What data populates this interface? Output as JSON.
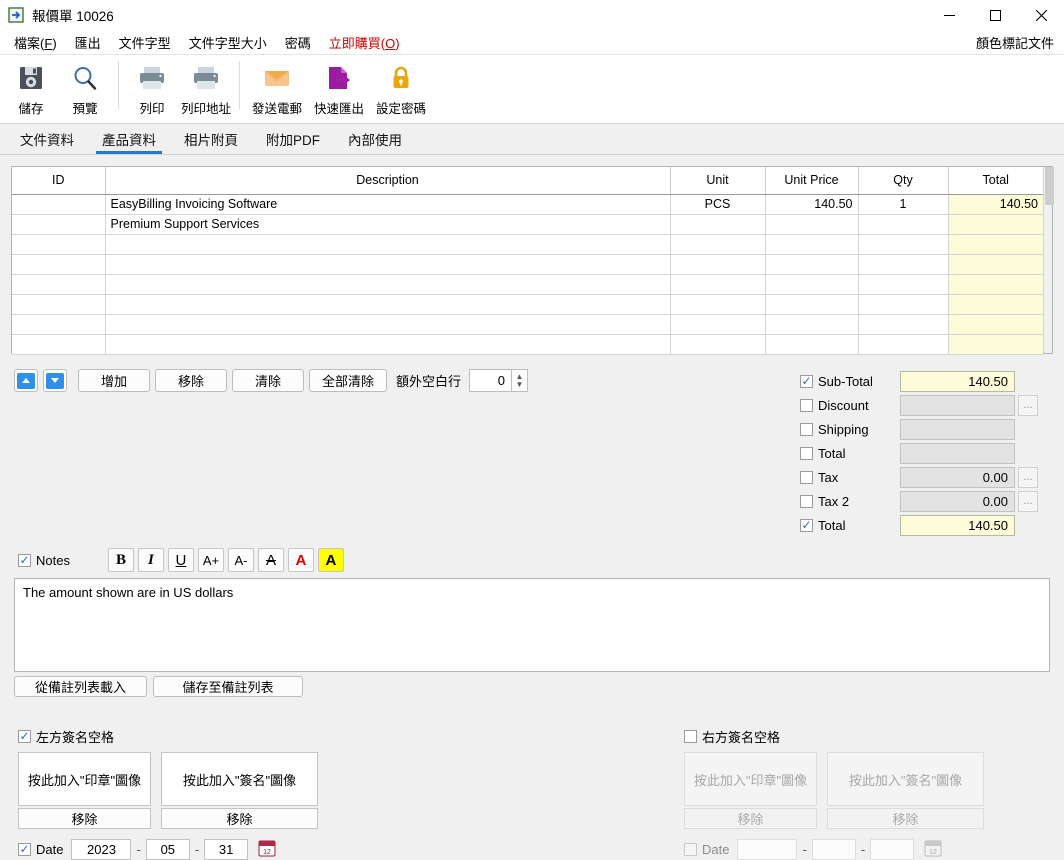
{
  "window": {
    "icon": "export-document-icon",
    "title": "報價單 10026",
    "minimize": "−",
    "maximize": "□",
    "close": "✕"
  },
  "menubar": {
    "items": [
      {
        "label": "檔案",
        "accel": "F",
        "name": "menu-file"
      },
      {
        "label": "匯出",
        "accel": "",
        "name": "menu-export"
      },
      {
        "label": "文件字型",
        "accel": "",
        "name": "menu-doc-font"
      },
      {
        "label": "文件字型大小",
        "accel": "",
        "name": "menu-doc-font-size"
      },
      {
        "label": "密碼",
        "accel": "",
        "name": "menu-password"
      },
      {
        "label": "立即購買",
        "accel": "O",
        "name": "menu-buy-now"
      }
    ],
    "right_label": "顏色標記文件"
  },
  "toolbar": {
    "buttons": [
      {
        "label": "儲存",
        "icon": "save-icon",
        "name": "toolbar-save"
      },
      {
        "label": "預覽",
        "icon": "preview-icon",
        "name": "toolbar-preview"
      },
      {
        "label": "列印",
        "icon": "print-icon",
        "name": "toolbar-print"
      },
      {
        "label": "列印地址",
        "icon": "print-address-icon",
        "name": "toolbar-print-address"
      },
      {
        "label": "發送電郵",
        "icon": "email-icon",
        "name": "toolbar-send-email"
      },
      {
        "label": "快速匯出",
        "icon": "quick-export-icon",
        "name": "toolbar-quick-export"
      },
      {
        "label": "設定密碼",
        "icon": "lock-icon",
        "name": "toolbar-set-password"
      }
    ]
  },
  "tabs": [
    {
      "label": "文件資料",
      "active": false,
      "name": "tab-document-data"
    },
    {
      "label": "產品資料",
      "active": true,
      "name": "tab-product-data"
    },
    {
      "label": "相片附頁",
      "active": false,
      "name": "tab-photo-attachment"
    },
    {
      "label": "附加PDF",
      "active": false,
      "name": "tab-attach-pdf"
    },
    {
      "label": "內部使用",
      "active": false,
      "name": "tab-internal-use"
    }
  ],
  "items_table": {
    "columns": [
      "ID",
      "Description",
      "Unit",
      "Unit Price",
      "Qty",
      "Total"
    ],
    "rows": [
      {
        "id": "",
        "description": "EasyBilling Invoicing Software",
        "unit": "PCS",
        "unit_price": "140.50",
        "qty": "1",
        "total": "140.50"
      },
      {
        "id": "",
        "description": "Premium Support Services",
        "unit": "",
        "unit_price": "",
        "qty": "",
        "total": ""
      },
      {
        "id": "",
        "description": "",
        "unit": "",
        "unit_price": "",
        "qty": "",
        "total": ""
      },
      {
        "id": "",
        "description": "",
        "unit": "",
        "unit_price": "",
        "qty": "",
        "total": ""
      },
      {
        "id": "",
        "description": "",
        "unit": "",
        "unit_price": "",
        "qty": "",
        "total": ""
      },
      {
        "id": "",
        "description": "",
        "unit": "",
        "unit_price": "",
        "qty": "",
        "total": ""
      },
      {
        "id": "",
        "description": "",
        "unit": "",
        "unit_price": "",
        "qty": "",
        "total": ""
      },
      {
        "id": "",
        "description": "",
        "unit": "",
        "unit_price": "",
        "qty": "",
        "total": ""
      }
    ]
  },
  "row_controls": {
    "move_up": "move-up-icon",
    "move_down": "move-down-icon",
    "add": "增加",
    "remove": "移除",
    "clear": "清除",
    "clear_all": "全部清除",
    "extra_blank_label": "額外空白行",
    "extra_blank_value": "0"
  },
  "totals": {
    "rows": [
      {
        "label": "Sub-Total",
        "checked": true,
        "value": "140.50",
        "highlight": true,
        "has_dots": false,
        "name": "total-row-subtotal"
      },
      {
        "label": "Discount",
        "checked": false,
        "value": "",
        "highlight": false,
        "has_dots": true,
        "name": "total-row-discount"
      },
      {
        "label": "Shipping",
        "checked": false,
        "value": "",
        "highlight": false,
        "has_dots": false,
        "name": "total-row-shipping"
      },
      {
        "label": "Total",
        "checked": false,
        "value": "",
        "highlight": false,
        "has_dots": false,
        "name": "total-row-total-mid"
      },
      {
        "label": "Tax",
        "checked": false,
        "value": "0.00",
        "highlight": false,
        "has_dots": true,
        "name": "total-row-tax"
      },
      {
        "label": "Tax 2",
        "checked": false,
        "value": "0.00",
        "highlight": false,
        "has_dots": true,
        "name": "total-row-tax2"
      },
      {
        "label": "Total",
        "checked": true,
        "value": "140.50",
        "highlight": true,
        "has_dots": false,
        "name": "total-row-grand-total"
      }
    ]
  },
  "notes": {
    "label": "Notes",
    "checked": true,
    "format_buttons": [
      {
        "glyph": "B",
        "name": "bold-button"
      },
      {
        "glyph": "I",
        "name": "italic-button"
      },
      {
        "glyph": "U",
        "name": "underline-button"
      },
      {
        "glyph": "A+",
        "name": "increase-font-size-button"
      },
      {
        "glyph": "A-",
        "name": "decrease-font-size-button"
      },
      {
        "glyph": "A",
        "name": "strikethrough-button"
      },
      {
        "glyph": "A",
        "name": "font-color-button"
      },
      {
        "glyph": "A",
        "name": "highlight-color-button"
      }
    ],
    "text": "The amount shown are in US dollars",
    "load_button": "從備註列表載入",
    "save_button": "儲存至備註列表"
  },
  "signatures": {
    "left": {
      "label": "左方簽名空格",
      "checked": true,
      "enabled": true,
      "stamp_button": "按此加入\"印章\"圖像",
      "sign_button": "按此加入\"簽名\"圖像",
      "remove_stamp": "移除",
      "remove_sign": "移除",
      "date_label": "Date",
      "date_checked": true,
      "year": "2023",
      "month": "05",
      "day": "31",
      "calendar_icon": "calendar-icon"
    },
    "right": {
      "label": "右方簽名空格",
      "checked": false,
      "enabled": false,
      "stamp_button": "按此加入\"印章\"圖像",
      "sign_button": "按此加入\"簽名\"圖像",
      "remove_stamp": "移除",
      "remove_sign": "移除",
      "date_label": "Date",
      "date_checked": false,
      "year": "",
      "month": "",
      "day": "",
      "calendar_icon": "calendar-icon"
    }
  },
  "colors": {
    "accent": "#2878c8",
    "highlight_field": "#fcfcd8",
    "buy_now": "#d00000"
  }
}
